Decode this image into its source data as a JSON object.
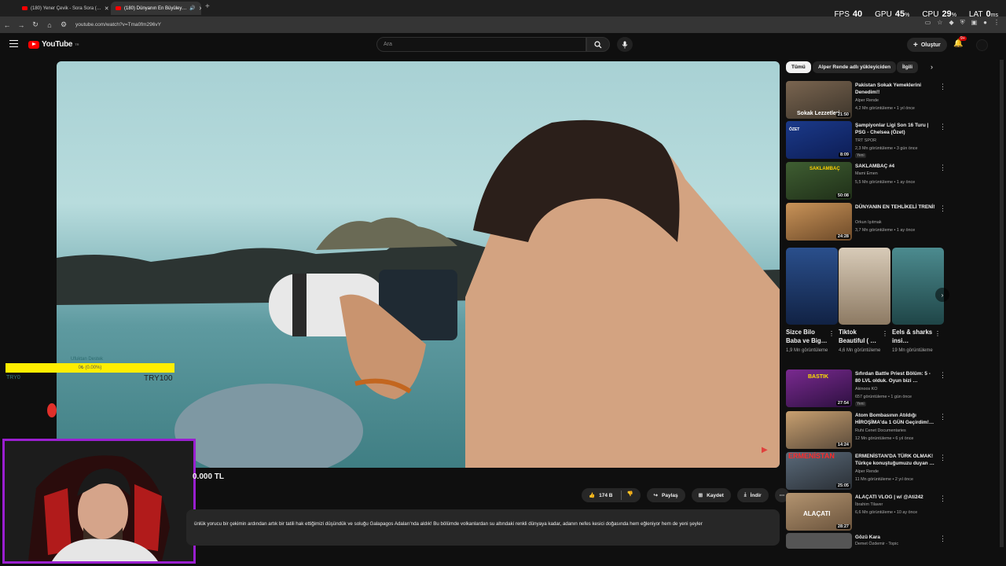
{
  "browser": {
    "tabs": [
      {
        "label": "(180) Yener Çevik - Sora Sora (…",
        "close": "✕"
      },
      {
        "label": "(180) Dünyanın En Büyüley…",
        "close": "✕"
      }
    ],
    "new_tab": "+",
    "url": "youtube.com/watch?v=Tma0fm296vY",
    "hud": {
      "fps_label": "FPS",
      "fps": "40",
      "gpu_label": "GPU",
      "gpu": "45",
      "cpu_label": "CPU",
      "cpu": "29",
      "lat_label": "LAT",
      "lat": "0",
      "pct": "%",
      "ms": "ms"
    }
  },
  "header": {
    "logo": "YouTube",
    "logo_region": "TR",
    "search_placeholder": "Ara",
    "create_label": "Oluştur",
    "notif_count": "9+"
  },
  "overlay": {
    "donation_label": "Ufuktan Destek",
    "donation_progress_text": "0₺ (0.00%)",
    "donation_progress": 0,
    "donation_goal": "TRY100",
    "donation_start": "TRY0"
  },
  "video": {
    "title_fragment": "0.000 TL",
    "likes": "174 B",
    "share": "Paylaş",
    "save": "Kaydet",
    "download": "İndir",
    "description": "ünlük yorucu bir çekimin ardından artık bir tatili hak ettiğimizi düşündük ve soluğu Galapagos Adaları'nda aldık! Bu bölümde volkanlardan su altındaki renkli dünyaya kadar, adanın nefes kesici doğasında hem eğleniyor hem de yeni şeyler"
  },
  "sidebar": {
    "chips": [
      "Tümü",
      "Alper Rende adlı yükleyiciden",
      "İlgili"
    ],
    "videos": [
      {
        "title": "Pakistan Sokak Yemeklerini Denedim!!",
        "channel": "Alper Rende",
        "meta": "4,2 Mn görüntüleme • 1 yıl önce",
        "dur": "21:50",
        "caption": "Sokak Lezzetleri",
        "new": ""
      },
      {
        "title": "Şampiyonlar Ligi Son 16 Turu | PSG - Chelsea (Özet)",
        "channel": "TRT SPOR",
        "meta": "2,3 Mn görüntüleme • 3 gün önce",
        "dur": "8:09",
        "caption": "ÖZET",
        "new": "Yeni"
      },
      {
        "title": "SAKLAMBAÇ #4",
        "channel": "Mami Emen",
        "meta": "5,5 Mn görüntüleme • 1 ay önce",
        "dur": "50:08",
        "caption": "SAKLAMBAÇ",
        "new": ""
      },
      {
        "title": "DÜNYANIN EN TEHLİKELİ TRENİ!",
        "channel": "Orkun Işıtmak",
        "meta": "3,7 Mn görüntüleme • 1 ay önce",
        "dur": "24:28",
        "caption": "",
        "new": ""
      },
      {
        "title": "Sıfırdan Battle Priest Bölüm: 5 - 80 LVL olduk. Oyun bizi …",
        "channel": "Akinoos KO",
        "meta": "657 görüntüleme • 1 gün önce",
        "dur": "27:54",
        "caption": "BASTIK",
        "new": "Yeni"
      },
      {
        "title": "Atom Bombasının Atıldığı HİROŞİMA'da 1 GÜN Geçirdim!…",
        "channel": "Ruhi Cenet Documentaries",
        "meta": "12 Mn görüntüleme • 6 yıl önce",
        "dur": "14:24",
        "caption": "",
        "new": ""
      },
      {
        "title": "ERMENİSTAN'DA TÜRK OLMAK! Türkçe konuştuğumuzu duyan …",
        "channel": "Alper Rende",
        "meta": "11 Mn görüntüleme • 2 yıl önce",
        "dur": "25:05",
        "caption": "ERMENİSTAN",
        "new": ""
      },
      {
        "title": "ALAÇATI VLOG | w/ @Ati242",
        "channel": "İbrahim Tilaver",
        "meta": "6,6 Mn görüntüleme • 10 ay önce",
        "dur": "28:27",
        "caption": "ALAÇATI",
        "new": ""
      },
      {
        "title": "Gözü Kara",
        "channel": "Demet Özdemir - Topic",
        "meta": "",
        "dur": "",
        "caption": "",
        "new": ""
      }
    ],
    "shorts": [
      {
        "title": "Sizce Bilo Baba ve Big…",
        "meta": "1,9 Mn görüntüleme"
      },
      {
        "title": "Tiktok Beautiful ( …",
        "meta": "4,6 Mn görüntüleme"
      },
      {
        "title": "Eels & sharks insi…",
        "meta": "19 Mn görüntüleme"
      }
    ]
  },
  "colors": {
    "accent": "#ff0000",
    "webcam_border": "#9a1fd0",
    "donation_bar": "#ffee00",
    "background": "#0f0f0f"
  }
}
